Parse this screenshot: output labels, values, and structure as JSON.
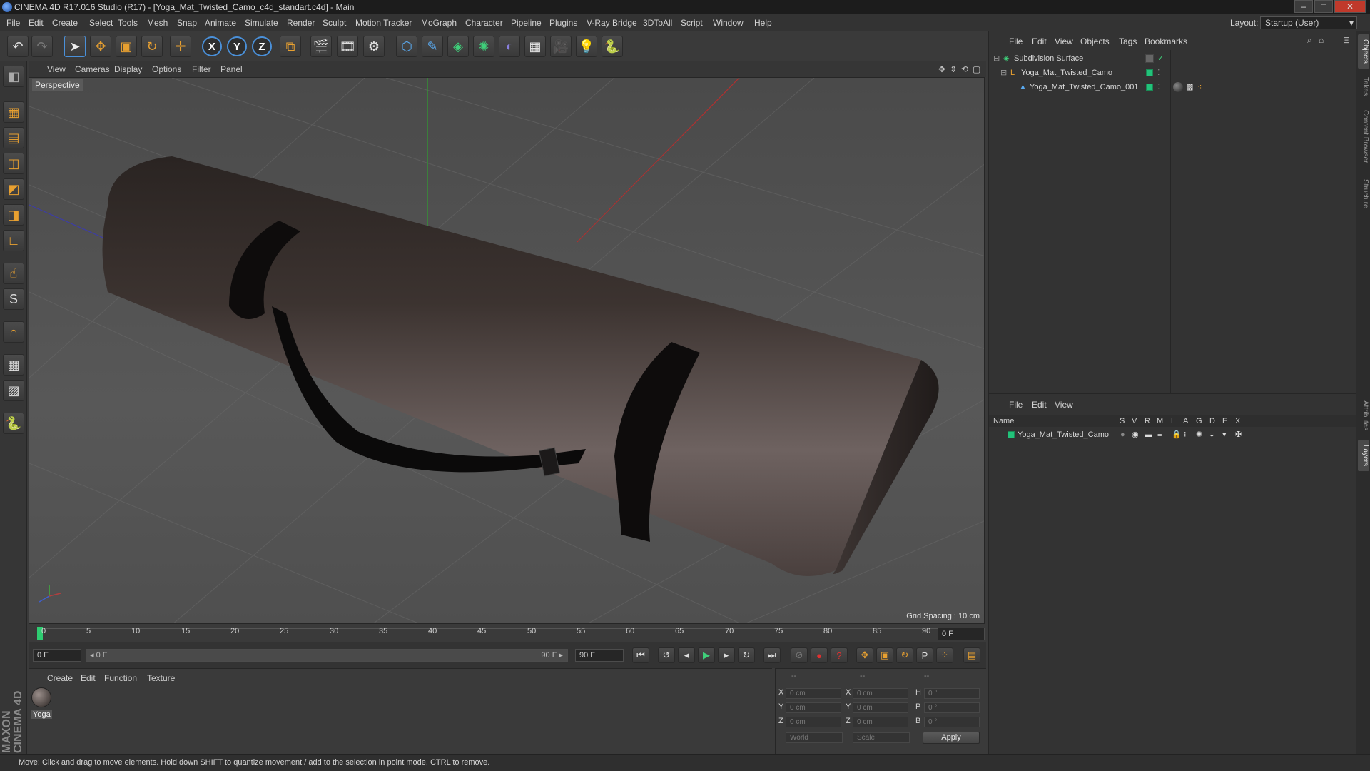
{
  "window": {
    "title": "CINEMA 4D R17.016 Studio (R17) - [Yoga_Mat_Twisted_Camo_c4d_standart.c4d] - Main",
    "controls": [
      "–",
      "□",
      "✕"
    ]
  },
  "menubar": {
    "items": [
      "File",
      "Edit",
      "Create",
      "Select",
      "Tools",
      "Mesh",
      "Snap",
      "Animate",
      "Simulate",
      "Render",
      "Sculpt",
      "Motion Tracker",
      "MoGraph",
      "Character",
      "Pipeline",
      "Plugins",
      "V-Ray Bridge",
      "3DToAll",
      "Script",
      "Window",
      "Help"
    ],
    "layout_label": "Layout:",
    "layout_value": "Startup (User)"
  },
  "toolbar": {
    "undo": "↶",
    "redo": "↷",
    "select": "➤",
    "move": "✥",
    "scale": "▣",
    "rotate": "↻",
    "live": "✛",
    "x": "X",
    "y": "Y",
    "z": "Z",
    "coord": "⧉",
    "render_view": "🎬",
    "render_pic": "🎞",
    "render_settings": "⚙",
    "cube": "⬡",
    "pen": "✎",
    "subdiv": "◈",
    "array": "✺",
    "deformer": "◐",
    "floor": "▦",
    "camera": "🎥",
    "light": "💡",
    "python": "🐍"
  },
  "left_tools": [
    "◧",
    "▦",
    "▤",
    "◫",
    "◩",
    "◨",
    "∟",
    "☝",
    "S",
    "∩",
    "▩",
    "▨",
    "🐍"
  ],
  "brand": "MAXON CINEMA 4D",
  "viewport": {
    "menu": [
      "View",
      "Cameras",
      "Display",
      "Options",
      "Filter",
      "Panel"
    ],
    "label": "Perspective",
    "grid_spacing": "Grid Spacing : 10 cm",
    "nav_icons": [
      "✥",
      "⇕",
      "⟲",
      "▢"
    ]
  },
  "timeline": {
    "ticks": [
      "0",
      "5",
      "10",
      "15",
      "20",
      "25",
      "30",
      "35",
      "40",
      "45",
      "50",
      "55",
      "60",
      "65",
      "70",
      "75",
      "80",
      "85",
      "90"
    ],
    "current_frame": "0 F",
    "start_field": "0 F",
    "range_start": "◂ 0 F",
    "range_end": "90 F ▸",
    "end_field": "90 F"
  },
  "playback": {
    "buttons": [
      "⏮",
      "↺",
      "◂",
      "▶",
      "▸",
      "↻",
      "⏭"
    ],
    "key_buttons": [
      "⊘",
      "●",
      "?"
    ],
    "mode_buttons": [
      "✥",
      "▣",
      "↻",
      "P",
      "⁘",
      "▤"
    ]
  },
  "material_panel": {
    "menu": [
      "Create",
      "Edit",
      "Function",
      "Texture"
    ],
    "material_name": "Yoga"
  },
  "coords": {
    "headers": [
      "--",
      "--",
      "--"
    ],
    "rows": [
      {
        "a": "X",
        "av": "0 cm",
        "b": "X",
        "bv": "0 cm",
        "c": "H",
        "cv": "0 °"
      },
      {
        "a": "Y",
        "av": "0 cm",
        "b": "Y",
        "bv": "0 cm",
        "c": "P",
        "cv": "0 °"
      },
      {
        "a": "Z",
        "av": "0 cm",
        "b": "Z",
        "bv": "0 cm",
        "c": "B",
        "cv": "0 °"
      }
    ],
    "world": "World",
    "scale": "Scale",
    "apply": "Apply"
  },
  "objects_panel": {
    "menu": [
      "File",
      "Edit",
      "View",
      "Objects",
      "Tags",
      "Bookmarks"
    ],
    "items": [
      {
        "name": "Subdivision Surface",
        "indent": 0
      },
      {
        "name": "Yoga_Mat_Twisted_Camo",
        "indent": 1
      },
      {
        "name": "Yoga_Mat_Twisted_Camo_001",
        "indent": 2
      }
    ]
  },
  "layers_panel": {
    "menu": [
      "File",
      "Edit",
      "View"
    ],
    "columns": [
      "Name",
      "S",
      "V",
      "R",
      "M",
      "L",
      "A",
      "G",
      "D",
      "E",
      "X"
    ],
    "layers": [
      {
        "name": "Yoga_Mat_Twisted_Camo"
      }
    ]
  },
  "right_tabs": [
    "Objects",
    "Takes",
    "Content Browser",
    "Structure",
    "Attributes",
    "Layers"
  ],
  "status": "Move: Click and drag to move elements. Hold down SHIFT to quantize movement / add to the selection in point mode, CTRL to remove.",
  "colors": {
    "accent": "#4a90d9",
    "layer_green": "#22c27a"
  }
}
